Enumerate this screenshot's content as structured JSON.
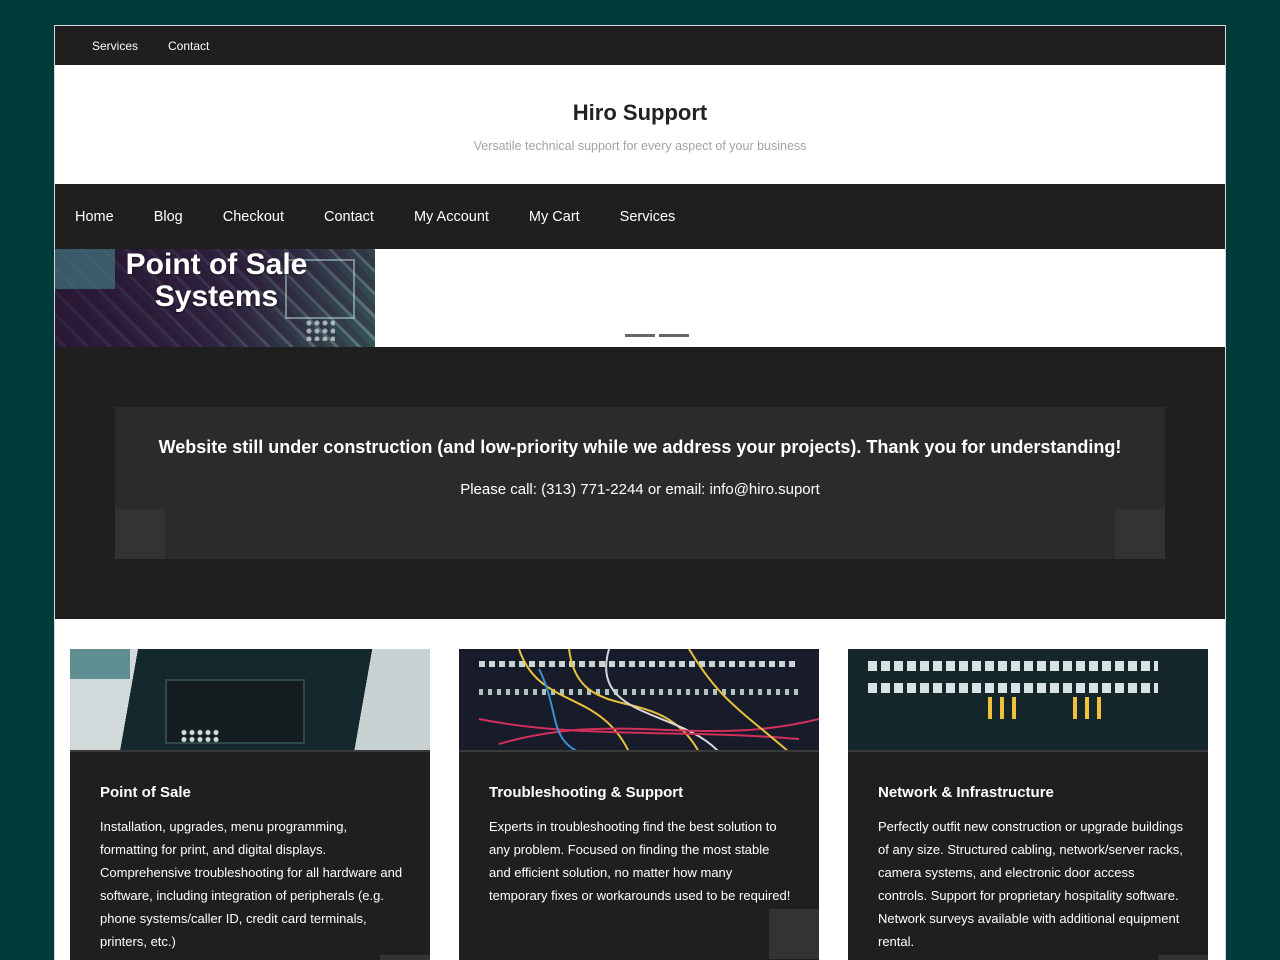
{
  "top_menu": {
    "items": [
      "Services",
      "Contact"
    ]
  },
  "header": {
    "title": "Hiro Support",
    "tagline": "Versatile technical support for every aspect of your business"
  },
  "main_nav": {
    "items": [
      "Home",
      "Blog",
      "Checkout",
      "Contact",
      "My Account",
      "My Cart",
      "Services"
    ]
  },
  "slider": {
    "slide_title": "Point of Sale Systems",
    "dot_count": 2
  },
  "notice": {
    "heading": "Website still under construction (and low-priority while we address your projects). Thank you for understanding!",
    "contact": "Please call: (313) 771-2244 or email: info@hiro.suport"
  },
  "cards": [
    {
      "title": "Point of Sale",
      "text": "Installation, upgrades, menu programming, formatting for print, and digital displays. Comprehensive troubleshooting for all hardware and software, including integration of peripherals (e.g. phone systems/caller ID, credit card terminals, printers, etc.)"
    },
    {
      "title": "Troubleshooting & Support",
      "text": "Experts in troubleshooting find the best solution to any problem. Focused on finding the most stable and efficient solution, no matter how many temporary fixes or workarounds used to be required!"
    },
    {
      "title": "Network & Infrastructure",
      "text": "Perfectly outfit new construction or upgrade buildings of any size. Structured cabling, network/server racks, camera systems, and electronic door access controls. Support for proprietary hospitality software. Network surveys available with additional equipment rental."
    }
  ],
  "colors": {
    "background": "#003a3a",
    "bar": "#1f1f1f",
    "notice_box": "#2b2b2b"
  }
}
